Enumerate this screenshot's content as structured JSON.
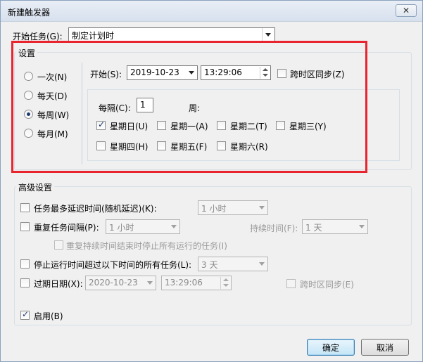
{
  "title": "新建触发器",
  "begin_task": {
    "label": "开始任务(G):",
    "value": "制定计划时"
  },
  "settings": {
    "title": "设置",
    "options": [
      {
        "label": "一次(N)",
        "checked": false
      },
      {
        "label": "每天(D)",
        "checked": false
      },
      {
        "label": "每周(W)",
        "checked": true
      },
      {
        "label": "每月(M)",
        "checked": false
      }
    ],
    "start_label": "开始(S):",
    "start_date": "2019-10-23",
    "start_time": "13:29:06",
    "sync_tz_label": "跨时区同步(Z)",
    "every_label": "每隔(C):",
    "every_value": "1",
    "week_unit": "周:",
    "days": [
      {
        "label": "星期日(U)",
        "checked": true
      },
      {
        "label": "星期一(A)",
        "checked": false
      },
      {
        "label": "星期二(T)",
        "checked": false
      },
      {
        "label": "星期三(Y)",
        "checked": false
      },
      {
        "label": "星期四(H)",
        "checked": false
      },
      {
        "label": "星期五(F)",
        "checked": false
      },
      {
        "label": "星期六(R)",
        "checked": false
      }
    ]
  },
  "advanced": {
    "title": "高级设置",
    "delay_label": "任务最多延迟时间(随机延迟)(K):",
    "delay_value": "1 小时",
    "repeat_label": "重复任务间隔(P):",
    "repeat_value": "1 小时",
    "duration_label": "持续时间(F):",
    "duration_value": "1 天",
    "stop_all_label": "重复持续时间结束时停止所有运行的任务(I)",
    "stop_long_label": "停止运行时间超过以下时间的所有任务(L):",
    "stop_long_value": "3 天",
    "expire_label": "过期日期(X):",
    "expire_date": "2020-10-23",
    "expire_time": "13:29:06",
    "expire_sync_label": "跨时区同步(E)",
    "enabled_label": "启用(B)"
  },
  "buttons": {
    "ok": "确定",
    "cancel": "取消"
  },
  "colors": {
    "highlight": "#e8242f"
  }
}
